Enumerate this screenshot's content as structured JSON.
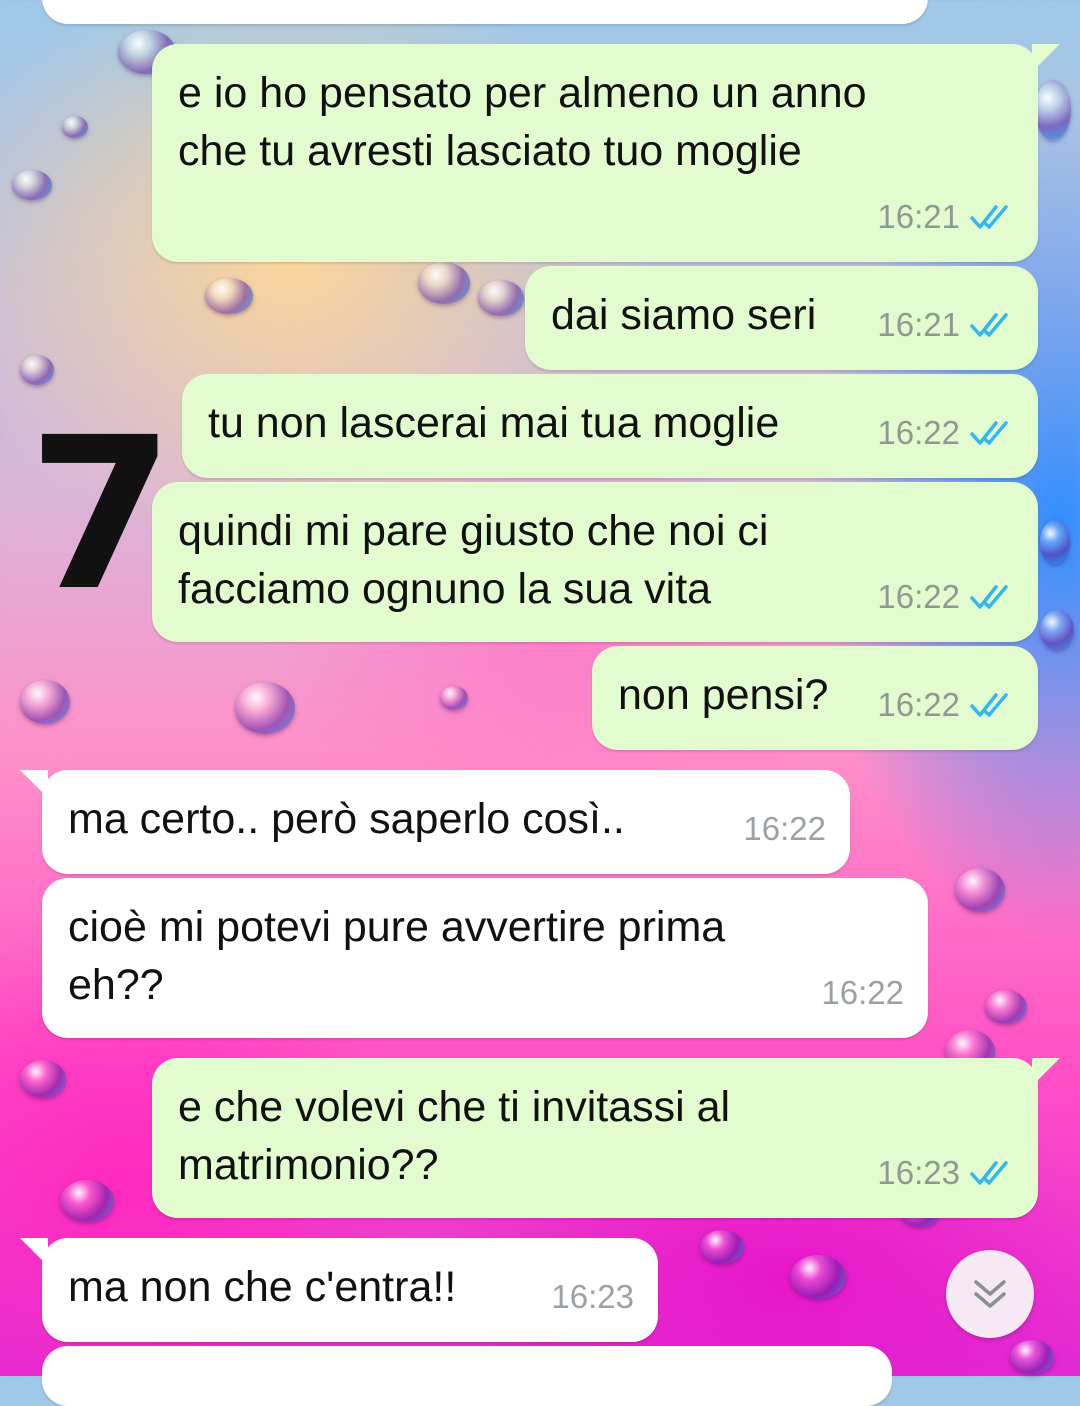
{
  "annotation_mark": "7",
  "messages": [
    {
      "text": "",
      "time": "",
      "direction": "in"
    },
    {
      "text": "e io ho pensato per almeno un anno\nche tu avresti lasciato tuo moglie",
      "time": "16:21",
      "direction": "out",
      "status": "read"
    },
    {
      "text": "dai siamo seri",
      "time": "16:21",
      "direction": "out",
      "status": "read"
    },
    {
      "text": "tu non lascerai mai tua moglie",
      "time": "16:22",
      "direction": "out",
      "status": "read"
    },
    {
      "text": "quindi mi pare giusto che noi ci\nfacciamo ognuno la sua vita",
      "time": "16:22",
      "direction": "out",
      "status": "read"
    },
    {
      "text": "non pensi?",
      "time": "16:22",
      "direction": "out",
      "status": "read"
    },
    {
      "text": "ma certo.. però saperlo così..",
      "time": "16:22",
      "direction": "in"
    },
    {
      "text": "cioè mi potevi pure avvertire prima\neh??",
      "time": "16:22",
      "direction": "in"
    },
    {
      "text": "e che volevi che ti invitassi al\nmatrimonio??",
      "time": "16:23",
      "direction": "out",
      "status": "read"
    },
    {
      "text": "ma non che c'entra!!",
      "time": "16:23",
      "direction": "in"
    },
    {
      "text": "",
      "time": "",
      "direction": "in"
    }
  ],
  "colors": {
    "outgoing_bubble": "#e2fbcf",
    "incoming_bubble": "#ffffff",
    "read_ticks": "#34b7f1",
    "scroll_button": "#f7e9f4"
  },
  "icons": {
    "read_status": "double-check-icon",
    "scroll_down": "chevron-double-down-icon"
  }
}
